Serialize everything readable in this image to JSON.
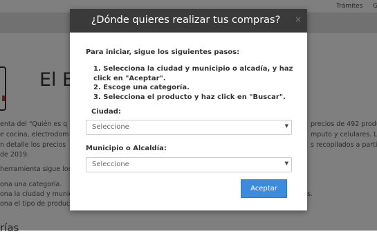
{
  "header": {
    "nav_tramites": "Trámites",
    "nav_g": "G"
  },
  "background": {
    "page_title": "El B",
    "lines": [
      "enta del \"Quién es q",
      "e cocina, electrodom",
      "n detalle los precios",
      "de 2019.",
      "herramienta sigue los",
      "ona una categoría.",
      "ona la ciudad y munic",
      "ona el tipo de produc"
    ],
    "right_lines": [
      "precios de 492 produ",
      "mputo y celulares. La",
      "s recopilados a partir",
      "s."
    ],
    "bottom_heading": "rías"
  },
  "modal": {
    "title": "¿Dónde quieres realizar tus compras?",
    "close": "×",
    "intro": "Para iniciar, sigue los siguientes pasos:",
    "steps": [
      "1. Selecciona la ciudad y municipio o alcadía, y haz click en \"Aceptar\".",
      "2. Escoge una categoría.",
      "3. Selecciona el producto y haz click en \"Buscar\"."
    ],
    "ciudad_label": "Ciudad:",
    "ciudad_value": "Seleccione",
    "municipio_label": "Municipio o Alcaldía:",
    "municipio_value": "Seleccione",
    "accept_label": "Aceptar"
  }
}
